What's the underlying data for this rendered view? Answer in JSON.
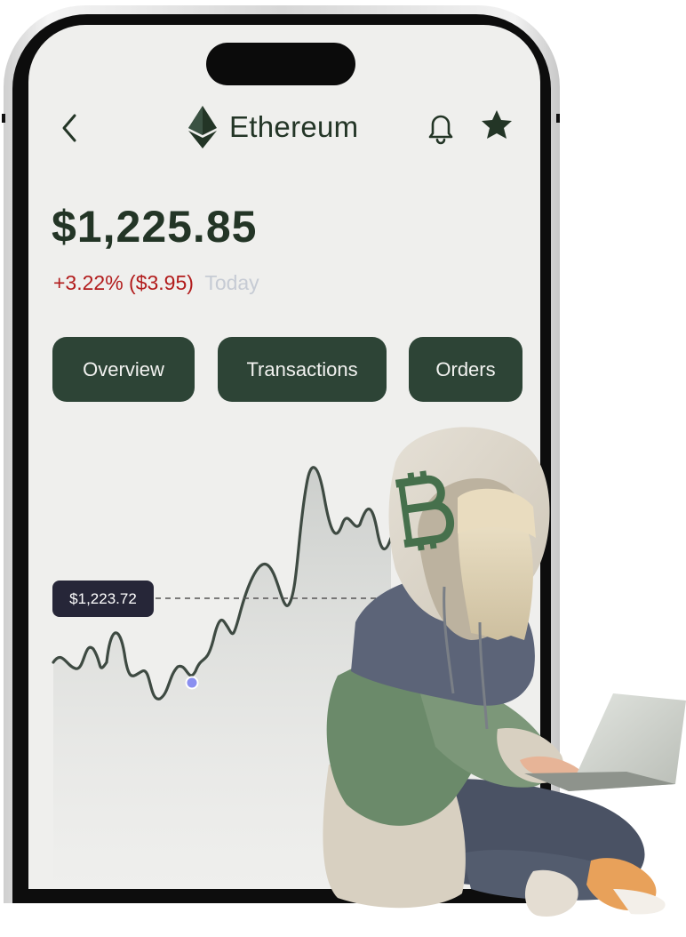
{
  "header": {
    "title": "Ethereum",
    "back_icon": "chevron-left-icon",
    "coin_icon": "ethereum-icon",
    "notification_icon": "bell-icon",
    "favorite_icon": "star-icon"
  },
  "price": {
    "value": "$1,225.85",
    "change": "+3.22% ($3.95)",
    "period": "Today",
    "change_color": "#b21c1c"
  },
  "tabs": [
    {
      "label": "Overview"
    },
    {
      "label": "Transactions"
    },
    {
      "label": "Orders"
    }
  ],
  "chart": {
    "tooltip_value": "$1,223.72",
    "type": "area",
    "line_color": "#3e4a42",
    "marker_color": "#8a8ff0"
  },
  "illustration": {
    "subject": "hooded-character-with-laptop",
    "hood_symbol": "bitcoin-icon"
  },
  "colors": {
    "brand": "#2d4436",
    "text": "#233526",
    "screen_bg": "#efefed"
  }
}
